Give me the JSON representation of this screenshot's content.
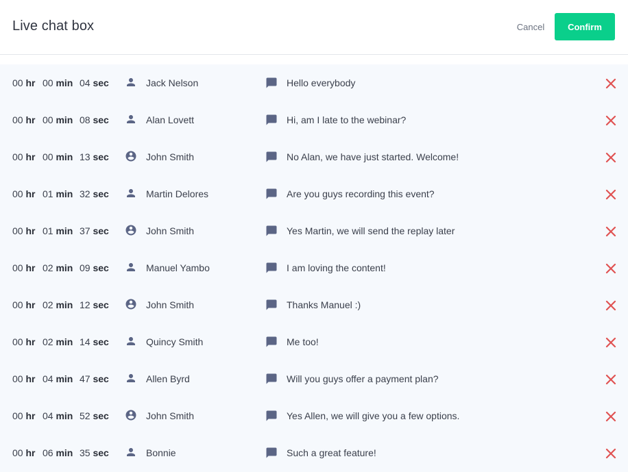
{
  "header": {
    "title": "Live chat box",
    "cancel_label": "Cancel",
    "confirm_label": "Confirm"
  },
  "units": {
    "hr": "hr",
    "min": "min",
    "sec": "sec"
  },
  "colors": {
    "accent": "#0acf8b",
    "delete": "#e05252",
    "icon": "#5b6585",
    "list_background": "#f6f9fd"
  },
  "messages": [
    {
      "hr": "00",
      "min": "00",
      "sec": "04",
      "user": "Jack Nelson",
      "role_icon": "person-icon",
      "text": "Hello everybody"
    },
    {
      "hr": "00",
      "min": "00",
      "sec": "08",
      "user": "Alan Lovett",
      "role_icon": "person-icon",
      "text": "Hi, am I late to the webinar?"
    },
    {
      "hr": "00",
      "min": "00",
      "sec": "13",
      "user": "John Smith",
      "role_icon": "account-circle-icon",
      "text": "No Alan, we have just started. Welcome!"
    },
    {
      "hr": "00",
      "min": "01",
      "sec": "32",
      "user": "Martin Delores",
      "role_icon": "person-icon",
      "text": "Are you guys recording this event?"
    },
    {
      "hr": "00",
      "min": "01",
      "sec": "37",
      "user": "John Smith",
      "role_icon": "account-circle-icon",
      "text": "Yes Martin, we will send the replay later"
    },
    {
      "hr": "00",
      "min": "02",
      "sec": "09",
      "user": "Manuel Yambo",
      "role_icon": "person-icon",
      "text": "I am loving the content!"
    },
    {
      "hr": "00",
      "min": "02",
      "sec": "12",
      "user": "John Smith",
      "role_icon": "account-circle-icon",
      "text": "Thanks Manuel :)"
    },
    {
      "hr": "00",
      "min": "02",
      "sec": "14",
      "user": "Quincy Smith",
      "role_icon": "person-icon",
      "text": "Me too!"
    },
    {
      "hr": "00",
      "min": "04",
      "sec": "47",
      "user": "Allen Byrd",
      "role_icon": "person-icon",
      "text": "Will you guys offer a payment plan?"
    },
    {
      "hr": "00",
      "min": "04",
      "sec": "52",
      "user": "John Smith",
      "role_icon": "account-circle-icon",
      "text": "Yes Allen, we will give you a few options."
    },
    {
      "hr": "00",
      "min": "06",
      "sec": "35",
      "user": "Bonnie",
      "role_icon": "person-icon",
      "text": "Such a great feature!"
    }
  ]
}
